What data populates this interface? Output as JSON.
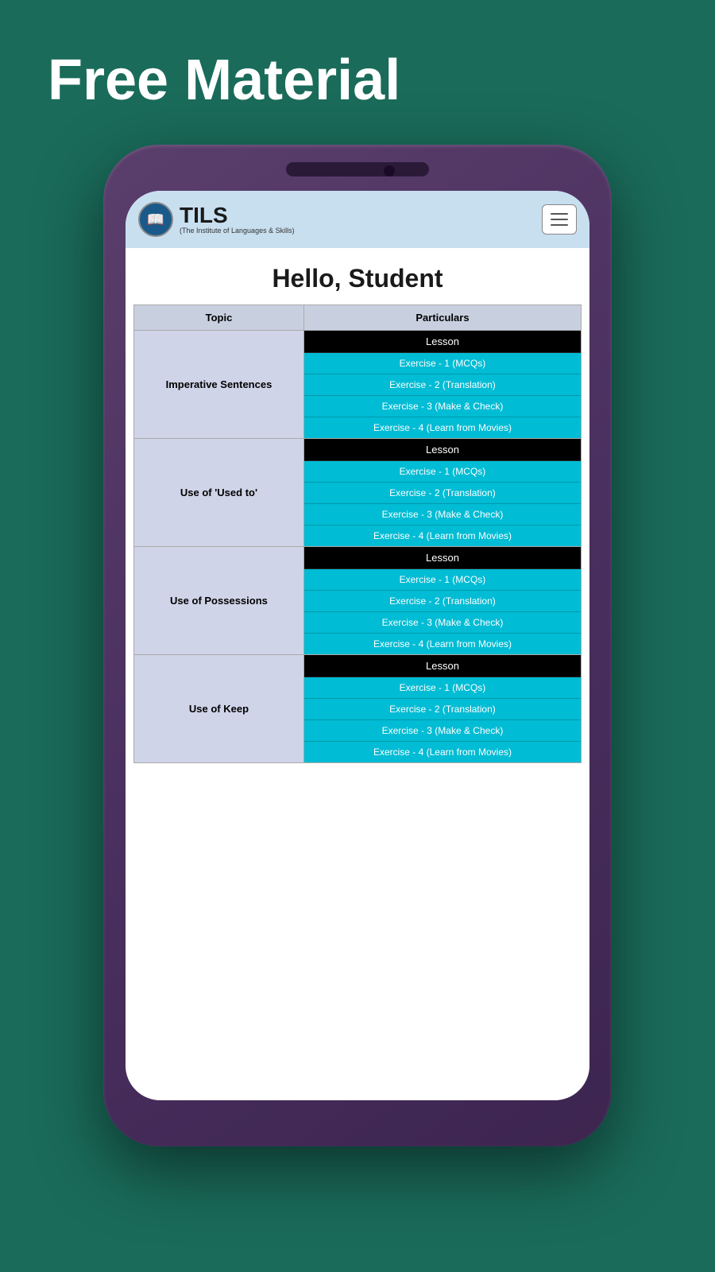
{
  "page": {
    "title": "Free Material",
    "greeting": "Hello, Student"
  },
  "nav": {
    "logo_text": "TILS",
    "logo_subtitle": "(The Institute of Languages & Skills)",
    "hamburger_label": "Menu"
  },
  "table": {
    "headers": [
      "Topic",
      "Particulars"
    ],
    "rows": [
      {
        "topic": "Imperative Sentences",
        "items": [
          {
            "type": "black",
            "label": "Lesson"
          },
          {
            "type": "blue",
            "label": "Exercise - 1 (MCQs)"
          },
          {
            "type": "blue",
            "label": "Exercise - 2 (Translation)"
          },
          {
            "type": "blue",
            "label": "Exercise - 3 (Make & Check)"
          },
          {
            "type": "blue",
            "label": "Exercise - 4 (Learn from Movies)"
          }
        ]
      },
      {
        "topic": "Use of 'Used to'",
        "items": [
          {
            "type": "black",
            "label": "Lesson"
          },
          {
            "type": "blue",
            "label": "Exercise - 1 (MCQs)"
          },
          {
            "type": "blue",
            "label": "Exercise - 2 (Translation)"
          },
          {
            "type": "blue",
            "label": "Exercise - 3 (Make & Check)"
          },
          {
            "type": "blue",
            "label": "Exercise - 4 (Learn from Movies)"
          }
        ]
      },
      {
        "topic": "Use of Possessions",
        "items": [
          {
            "type": "black",
            "label": "Lesson"
          },
          {
            "type": "blue",
            "label": "Exercise - 1 (MCQs)"
          },
          {
            "type": "blue",
            "label": "Exercise - 2 (Translation)"
          },
          {
            "type": "blue",
            "label": "Exercise - 3 (Make & Check)"
          },
          {
            "type": "blue",
            "label": "Exercise - 4 (Learn from Movies)"
          }
        ]
      },
      {
        "topic": "Use of Keep",
        "items": [
          {
            "type": "black",
            "label": "Lesson"
          },
          {
            "type": "blue",
            "label": "Exercise - 1 (MCQs)"
          },
          {
            "type": "blue",
            "label": "Exercise - 2 (Translation)"
          },
          {
            "type": "blue",
            "label": "Exercise - 3 (Make & Check)"
          },
          {
            "type": "blue",
            "label": "Exercise - 4 (Learn from Movies)"
          }
        ]
      }
    ]
  }
}
